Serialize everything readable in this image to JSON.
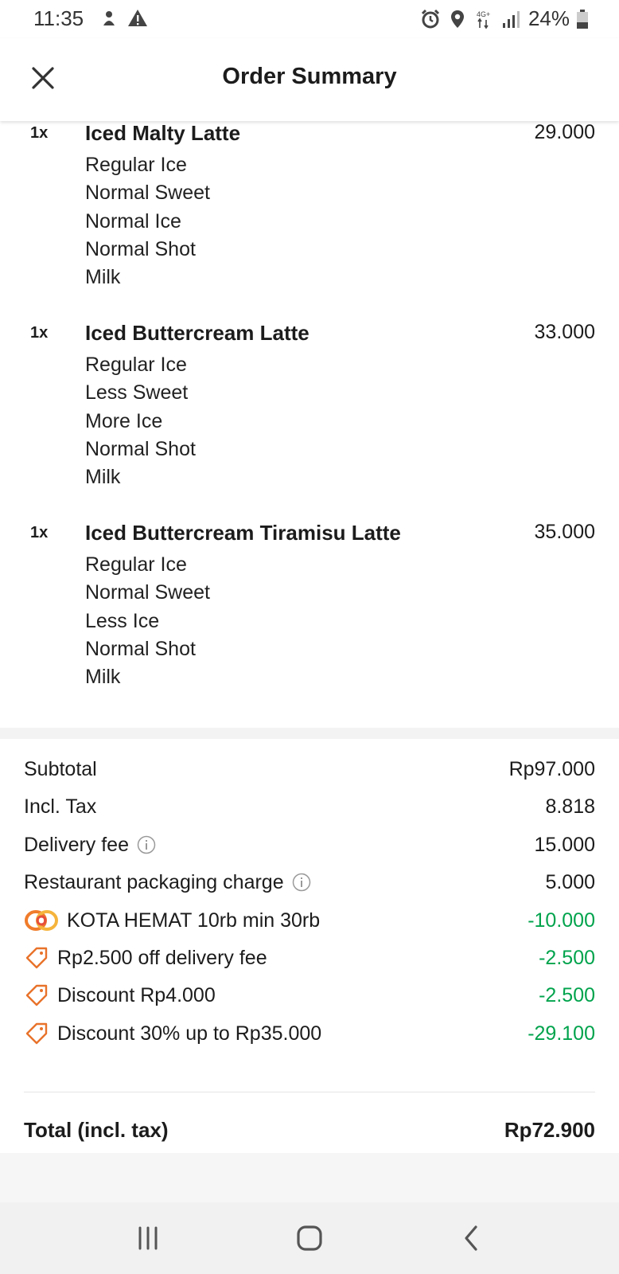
{
  "status_bar": {
    "time": "11:35",
    "network": "4G+",
    "battery": "24%"
  },
  "header": {
    "title": "Order Summary"
  },
  "items": [
    {
      "qty": "1x",
      "name": "Iced Malty Latte",
      "price": "29.000",
      "options": [
        "Regular Ice",
        "Normal Sweet",
        "Normal Ice",
        "Normal Shot",
        "Milk"
      ]
    },
    {
      "qty": "1x",
      "name": "Iced Buttercream Latte",
      "price": "33.000",
      "options": [
        "Regular Ice",
        "Less Sweet",
        "More Ice",
        "Normal Shot",
        "Milk"
      ]
    },
    {
      "qty": "1x",
      "name": "Iced Buttercream Tiramisu Latte",
      "price": "35.000",
      "options": [
        "Regular Ice",
        "Normal Sweet",
        "Less Ice",
        "Normal Shot",
        "Milk"
      ]
    }
  ],
  "summary": {
    "subtotal_label": "Subtotal",
    "subtotal_value": "Rp97.000",
    "tax_label": "Incl. Tax",
    "tax_value": "8.818",
    "delivery_label": "Delivery fee",
    "delivery_value": "15.000",
    "packaging_label": "Restaurant packaging charge",
    "packaging_value": "5.000",
    "promos": [
      {
        "label": "KOTA HEMAT 10rb min 30rb",
        "value": "-10.000",
        "icon": "kota-hemat-logo"
      },
      {
        "label": "Rp2.500 off delivery fee",
        "value": "-2.500",
        "icon": "tag-icon"
      },
      {
        "label": "Discount Rp4.000",
        "value": "-2.500",
        "icon": "tag-icon"
      },
      {
        "label": "Discount 30% up to Rp35.000",
        "value": "-29.100",
        "icon": "tag-icon"
      }
    ],
    "total_label": "Total (incl. tax)",
    "total_value": "Rp72.900"
  },
  "colors": {
    "discount_green": "#00a34c",
    "promo_orange": "#e8722a"
  }
}
